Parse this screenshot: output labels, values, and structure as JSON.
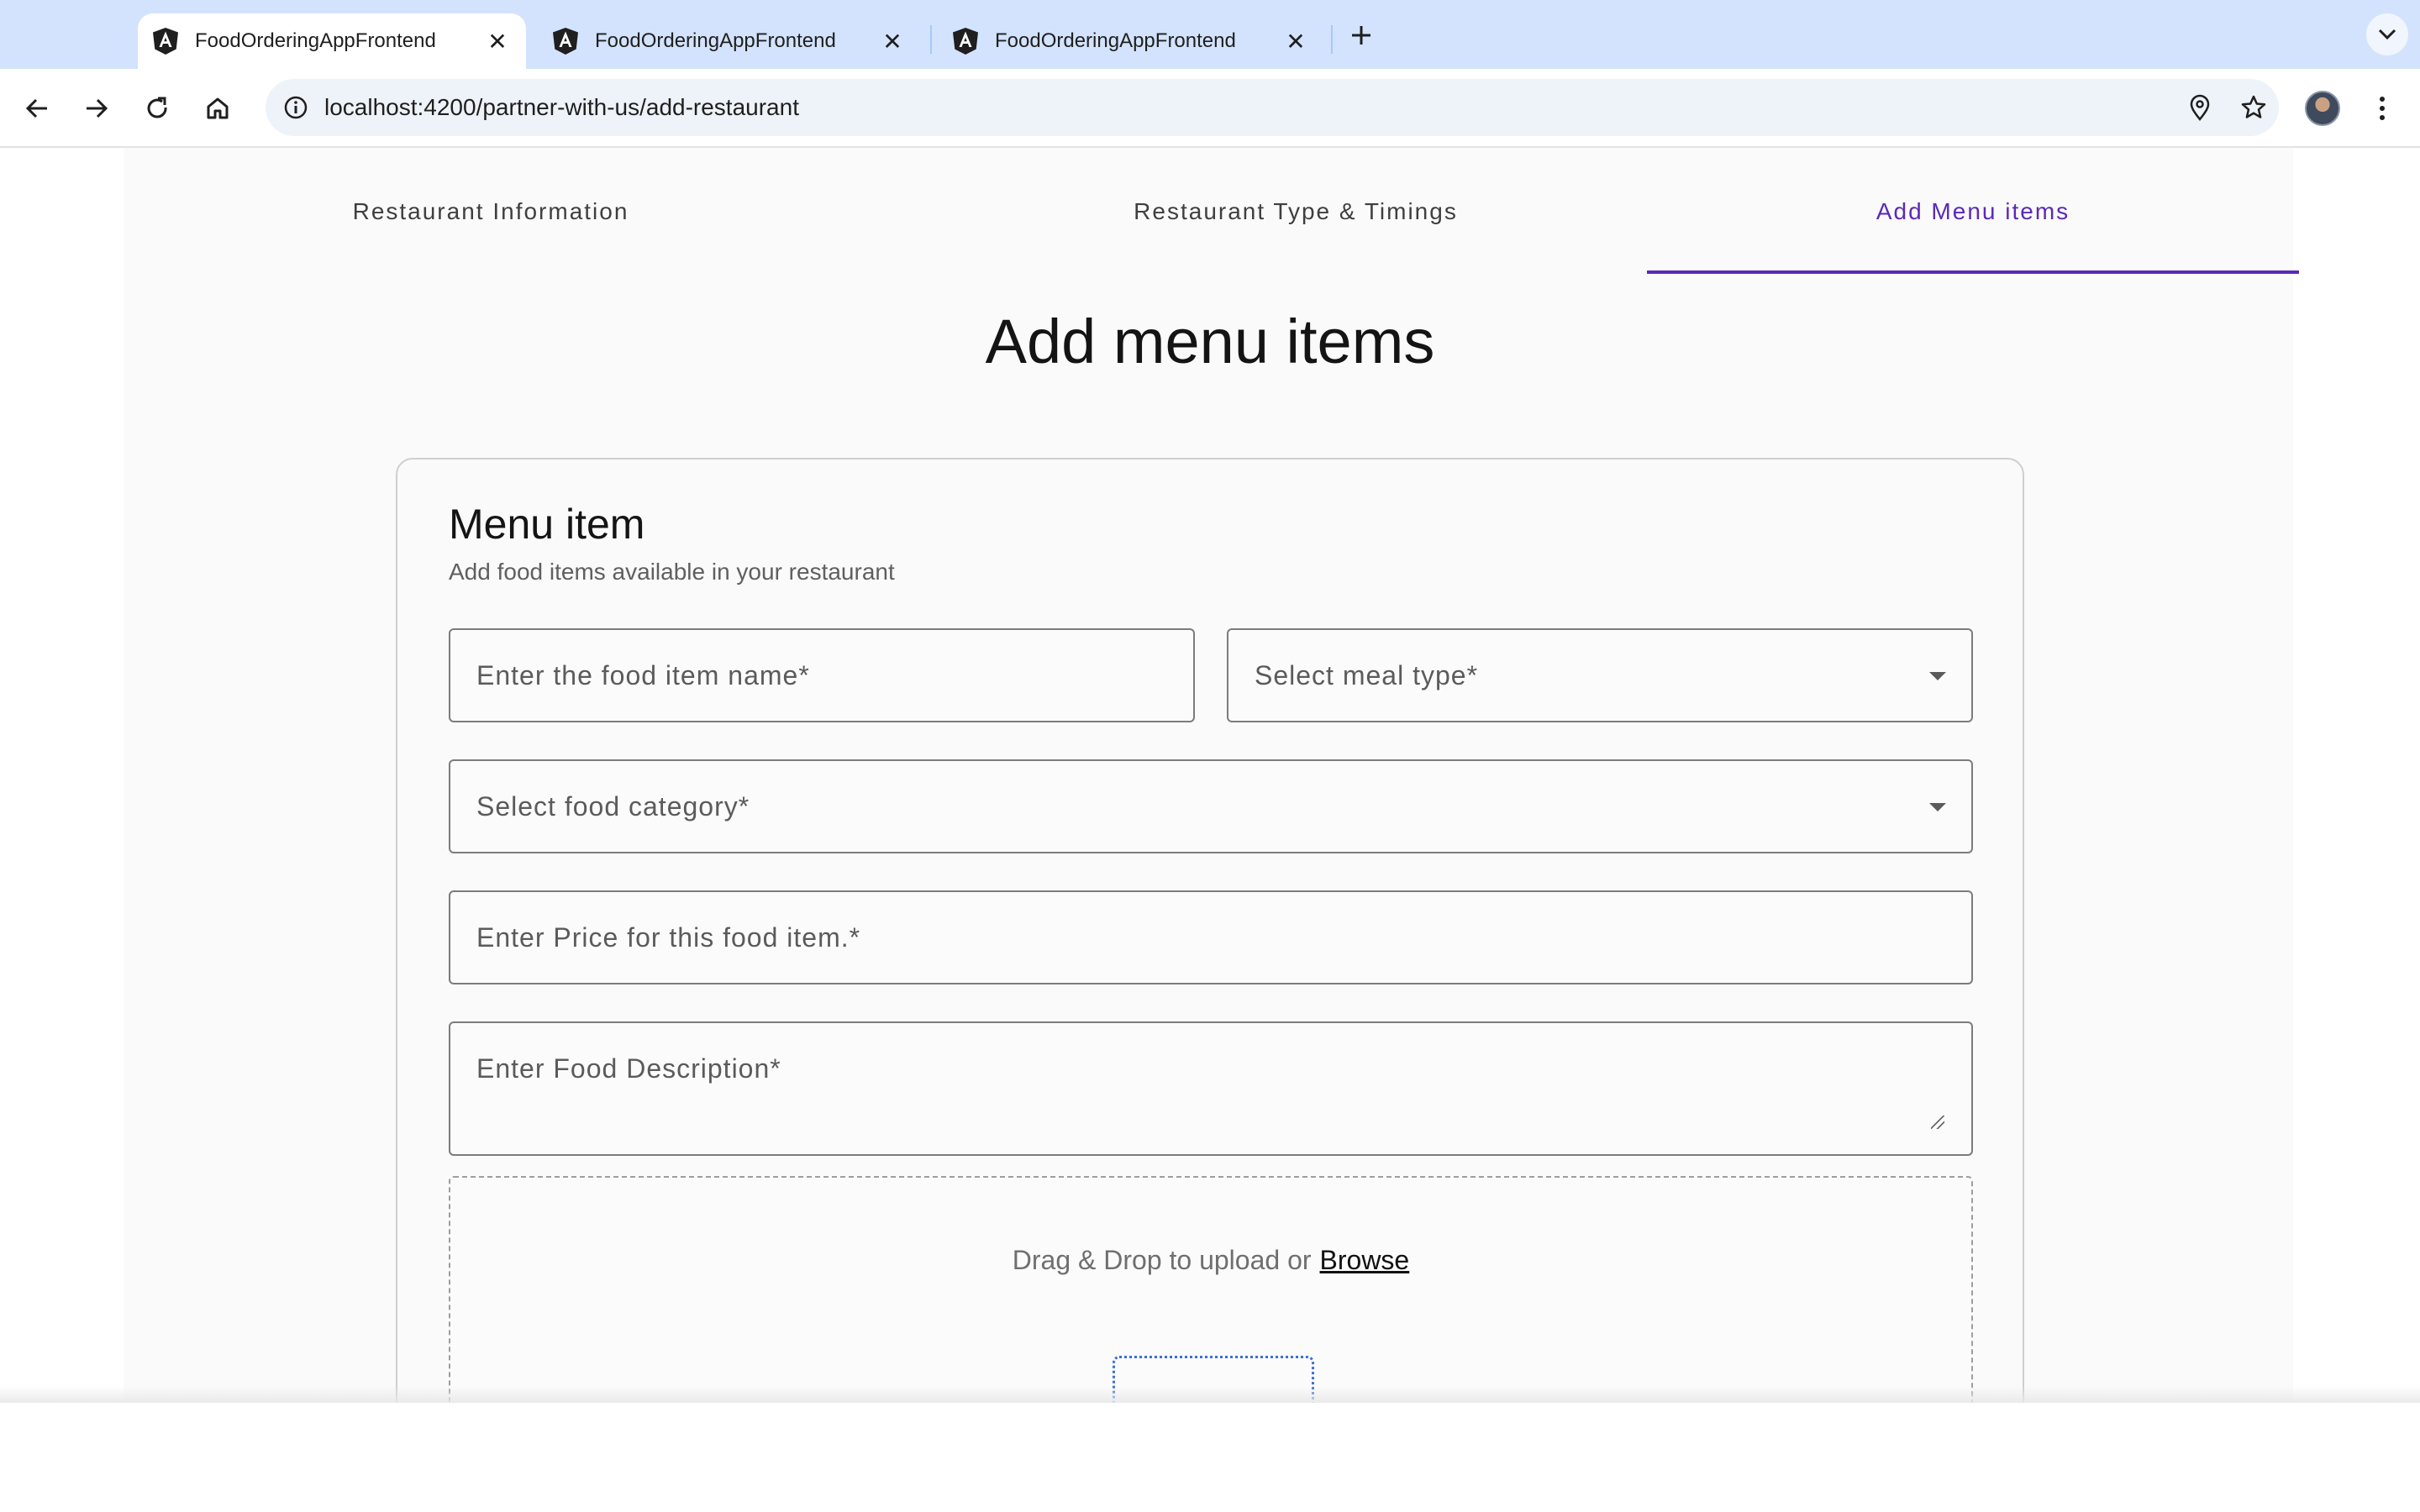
{
  "browser": {
    "tabs": [
      {
        "title": "FoodOrderingAppFrontend",
        "active": true
      },
      {
        "title": "FoodOrderingAppFrontend",
        "active": false
      },
      {
        "title": "FoodOrderingAppFrontend",
        "active": false
      }
    ],
    "new_tab_icon": "plus-icon",
    "url": "localhost:4200/partner-with-us/add-restaurant",
    "nav_icons": [
      "back-arrow-icon",
      "forward-arrow-icon",
      "reload-icon",
      "home-icon"
    ],
    "omnibox_icons": [
      "site-info-icon",
      "location-pin-icon",
      "bookmark-star-icon"
    ]
  },
  "stepper": {
    "tabs": [
      {
        "label": "Restaurant Information",
        "active": false
      },
      {
        "label": "Restaurant Type & Timings",
        "active": false
      },
      {
        "label": "Add Menu items",
        "active": true
      }
    ],
    "accent_color": "#5a2ab8"
  },
  "page": {
    "title": "Add menu items"
  },
  "card": {
    "title": "Menu item",
    "subtitle": "Add food items available in your restaurant",
    "fields": {
      "food_name": {
        "placeholder": "Enter the food item name*",
        "value": ""
      },
      "meal_type": {
        "placeholder": "Select meal type*",
        "value": ""
      },
      "food_category": {
        "placeholder": "Select food category*",
        "value": ""
      },
      "price": {
        "placeholder": "Enter Price for this food item.*",
        "value": ""
      },
      "description": {
        "placeholder": "Enter Food Description*",
        "value": ""
      }
    },
    "upload": {
      "text": "Drag & Drop to upload or",
      "browse_label": "Browse"
    }
  }
}
